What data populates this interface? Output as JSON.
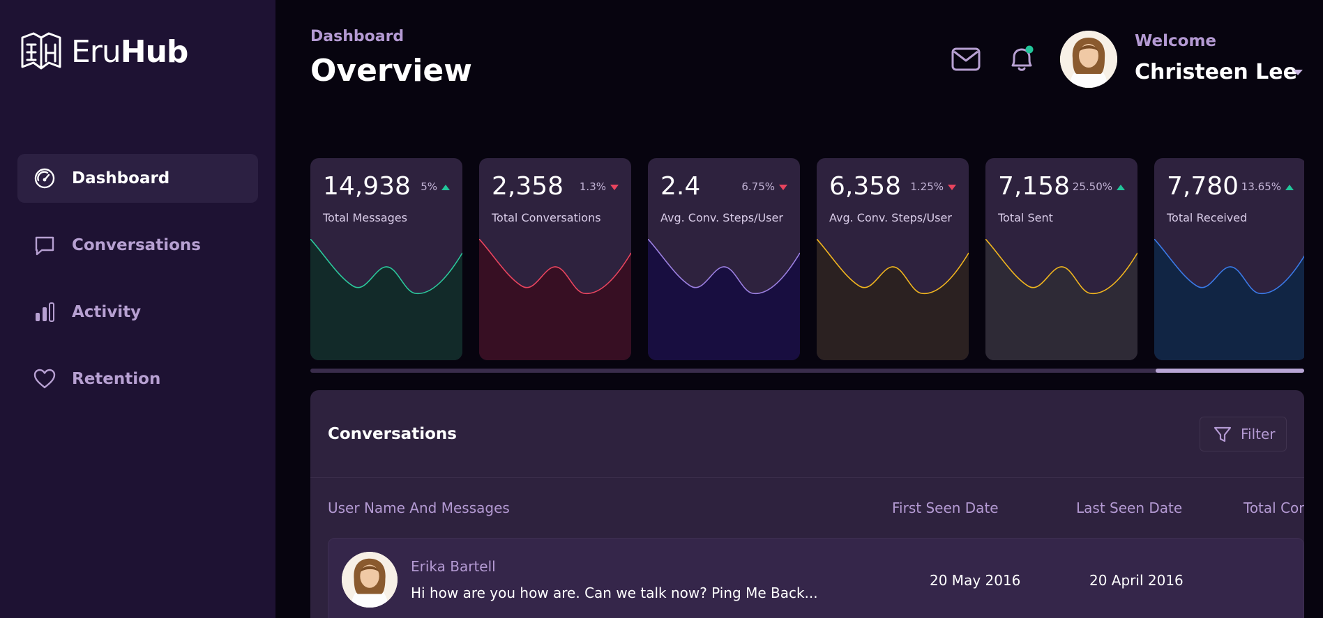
{
  "brand": {
    "name_light": "Eru",
    "name_bold": "Hub"
  },
  "sidebar": {
    "items": [
      {
        "label": "Dashboard",
        "icon": "gauge-icon",
        "active": true
      },
      {
        "label": "Conversations",
        "icon": "chat-icon",
        "active": false
      },
      {
        "label": "Activity",
        "icon": "bar-chart-icon",
        "active": false
      },
      {
        "label": "Retention",
        "icon": "heart-icon",
        "active": false
      }
    ]
  },
  "header": {
    "breadcrumb": "Dashboard",
    "title": "Overview",
    "welcome": "Welcome",
    "user_name": "Christeen Lee",
    "icons": [
      "mail-icon",
      "bell-icon"
    ],
    "notification_dot_color": "#22c59a"
  },
  "stats": [
    {
      "value": "14,938",
      "change": "5%",
      "trend": "up",
      "label": "Total Messages",
      "color": "#2bc79b",
      "fill": "#122a29"
    },
    {
      "value": "2,358",
      "change": "1.3%",
      "trend": "down",
      "label": "Total Conversations",
      "color": "#e8445e",
      "fill": "#370f23"
    },
    {
      "value": "2.4",
      "change": "6.75%",
      "trend": "down",
      "label": "Avg. Conv. Steps/User",
      "color": "#9b7fe0",
      "fill": "#180e40"
    },
    {
      "value": "6,358",
      "change": "1.25%",
      "trend": "down",
      "label": "Avg. Conv. Steps/User",
      "color": "#f0b51e",
      "fill": "#2b2121"
    },
    {
      "value": "7,158",
      "change": "25.50%",
      "trend": "up",
      "label": "Total Sent",
      "color": "#f0b51e",
      "fill": "#2e2a36"
    },
    {
      "value": "7,780",
      "change": "13.65%",
      "trend": "up",
      "label": "Total Received",
      "color": "#3a79e6",
      "fill": "#112544"
    }
  ],
  "conversations": {
    "title": "Conversations",
    "filter_label": "Filter",
    "columns": [
      "User Name And Messages",
      "First Seen Date",
      "Last Seen Date",
      "Total Con"
    ],
    "rows": [
      {
        "name": "Erika Bartell",
        "message": "Hi how are you how are. Can we talk now? Ping Me Back...",
        "first_seen": "20 May 2016",
        "last_seen": "20 April 2016"
      }
    ]
  }
}
